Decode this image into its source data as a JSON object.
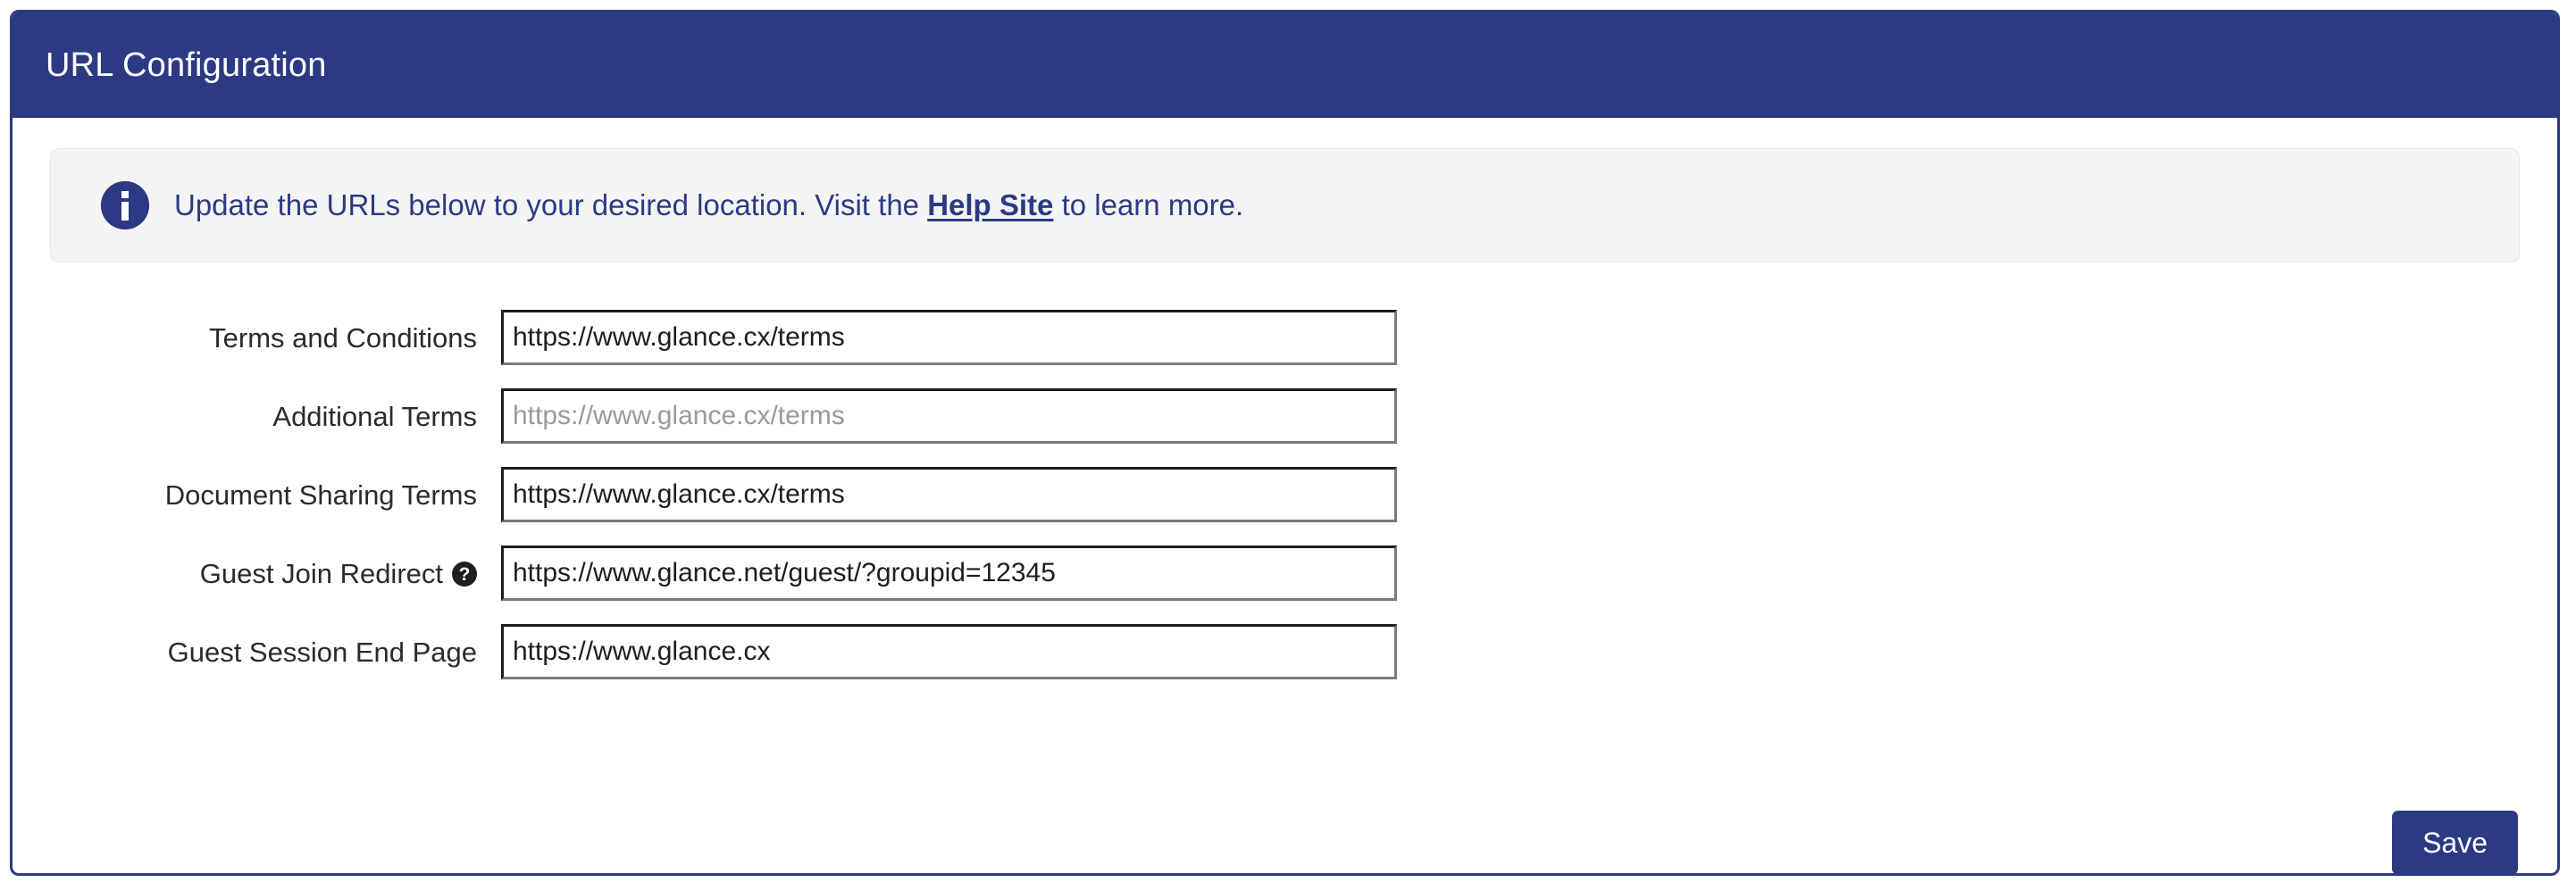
{
  "header": {
    "title": "URL Configuration"
  },
  "banner": {
    "icon": "info-icon",
    "text_before": "Update the URLs below to your desired location. Visit the ",
    "link_label": "Help Site",
    "text_after": " to learn more.",
    "accent_color": "#2B3A83",
    "background_color": "#F4F4F4"
  },
  "form": {
    "fields": [
      {
        "label": "Terms and Conditions",
        "value": "https://www.glance.cx/terms",
        "placeholder": "",
        "has_help_icon": false
      },
      {
        "label": "Additional Terms",
        "value": "",
        "placeholder": "https://www.glance.cx/terms",
        "has_help_icon": false
      },
      {
        "label": "Document Sharing Terms",
        "value": "https://www.glance.cx/terms",
        "placeholder": "",
        "has_help_icon": false
      },
      {
        "label": "Guest Join Redirect",
        "value": "https://www.glance.net/guest/?groupid=12345",
        "placeholder": "",
        "has_help_icon": true,
        "help_icon_glyph": "?"
      },
      {
        "label": "Guest Session End Page",
        "value": "https://www.glance.cx",
        "placeholder": "",
        "has_help_icon": false
      }
    ]
  },
  "actions": {
    "save_label": "Save",
    "save_color": "#2B3A83"
  }
}
